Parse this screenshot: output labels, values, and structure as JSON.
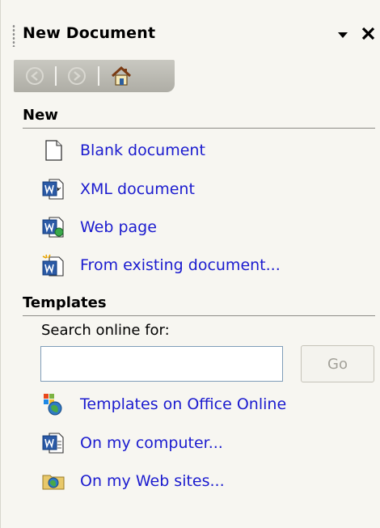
{
  "pane": {
    "title": "New Document",
    "dropdown_icon": "triangle-down-icon",
    "close_icon": "close-icon"
  },
  "nav": {
    "back_icon": "back-arrow-icon",
    "forward_icon": "forward-arrow-icon",
    "home_icon": "home-icon"
  },
  "new_section": {
    "header": "New",
    "items": [
      {
        "label": "Blank document",
        "icon": "blank-document-icon"
      },
      {
        "label": "XML document",
        "icon": "xml-document-icon"
      },
      {
        "label": "Web page",
        "icon": "web-page-icon"
      },
      {
        "label": "From existing document...",
        "icon": "existing-document-icon"
      }
    ]
  },
  "templates_section": {
    "header": "Templates",
    "search_label": "Search online for:",
    "search_value": "",
    "go_label": "Go",
    "items": [
      {
        "label": "Templates on Office Online",
        "icon": "office-online-icon"
      },
      {
        "label": "On my computer...",
        "icon": "word-document-icon"
      },
      {
        "label": "On my Web sites...",
        "icon": "web-folder-icon"
      }
    ]
  },
  "colors": {
    "link": "#1b1bcf",
    "pane_bg": "#f7f6f1",
    "nav_bar": "#b9b8b0"
  }
}
